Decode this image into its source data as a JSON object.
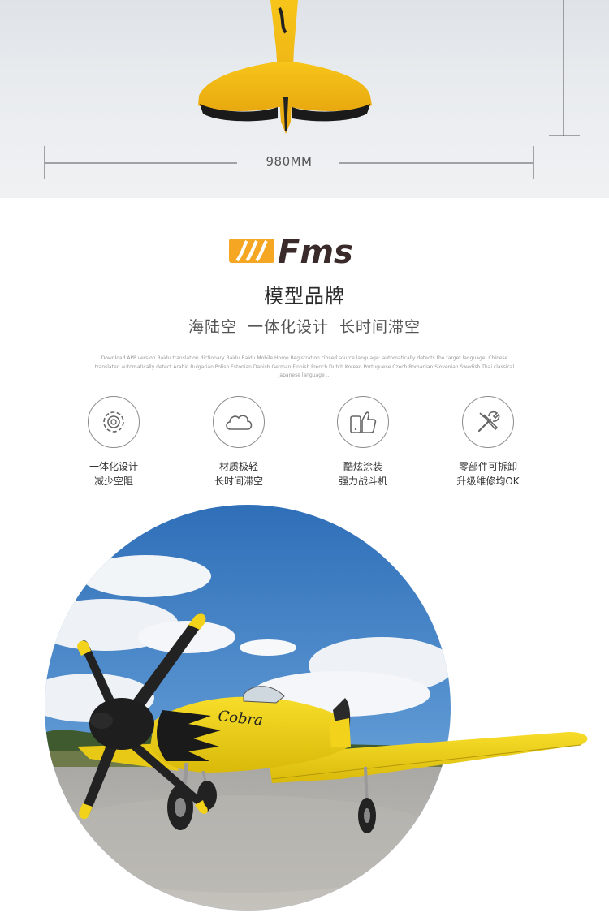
{
  "banner": {
    "dimension_label": "980MM"
  },
  "brand": {
    "logo_text": "Fms",
    "title": "模型品牌",
    "slogan": "海陆空  一体化设计  长时间滞空",
    "description": "Download APP version Baidu translation dictionary Baidu Baidu Mobile Home Registration closed source language: automatically detects the target language: Chinese translated automatically detect Arabic Bulgarian Polish Estonian Danish German Finnish French Dutch Korean Portuguese Czech Romanian Slovenian Swedish Thai classical Japanese language ..."
  },
  "features": [
    {
      "icon": "gear-icon",
      "line1": "一体化设计",
      "line2": "减少空阻"
    },
    {
      "icon": "cloud-icon",
      "line1": "材质极轻",
      "line2": "长时间滞空"
    },
    {
      "icon": "thumbs-up-phone-icon",
      "line1": "酷炫涂装",
      "line2": "强力战斗机"
    },
    {
      "icon": "tools-icon",
      "line1": "零部件可拆卸",
      "line2": "升级维修均OK"
    }
  ],
  "colors": {
    "brand_orange": "#f5a623",
    "brand_dark": "#3a2a2a",
    "plane_yellow": "#f2d21b",
    "sky_blue": "#3f7fc4"
  }
}
